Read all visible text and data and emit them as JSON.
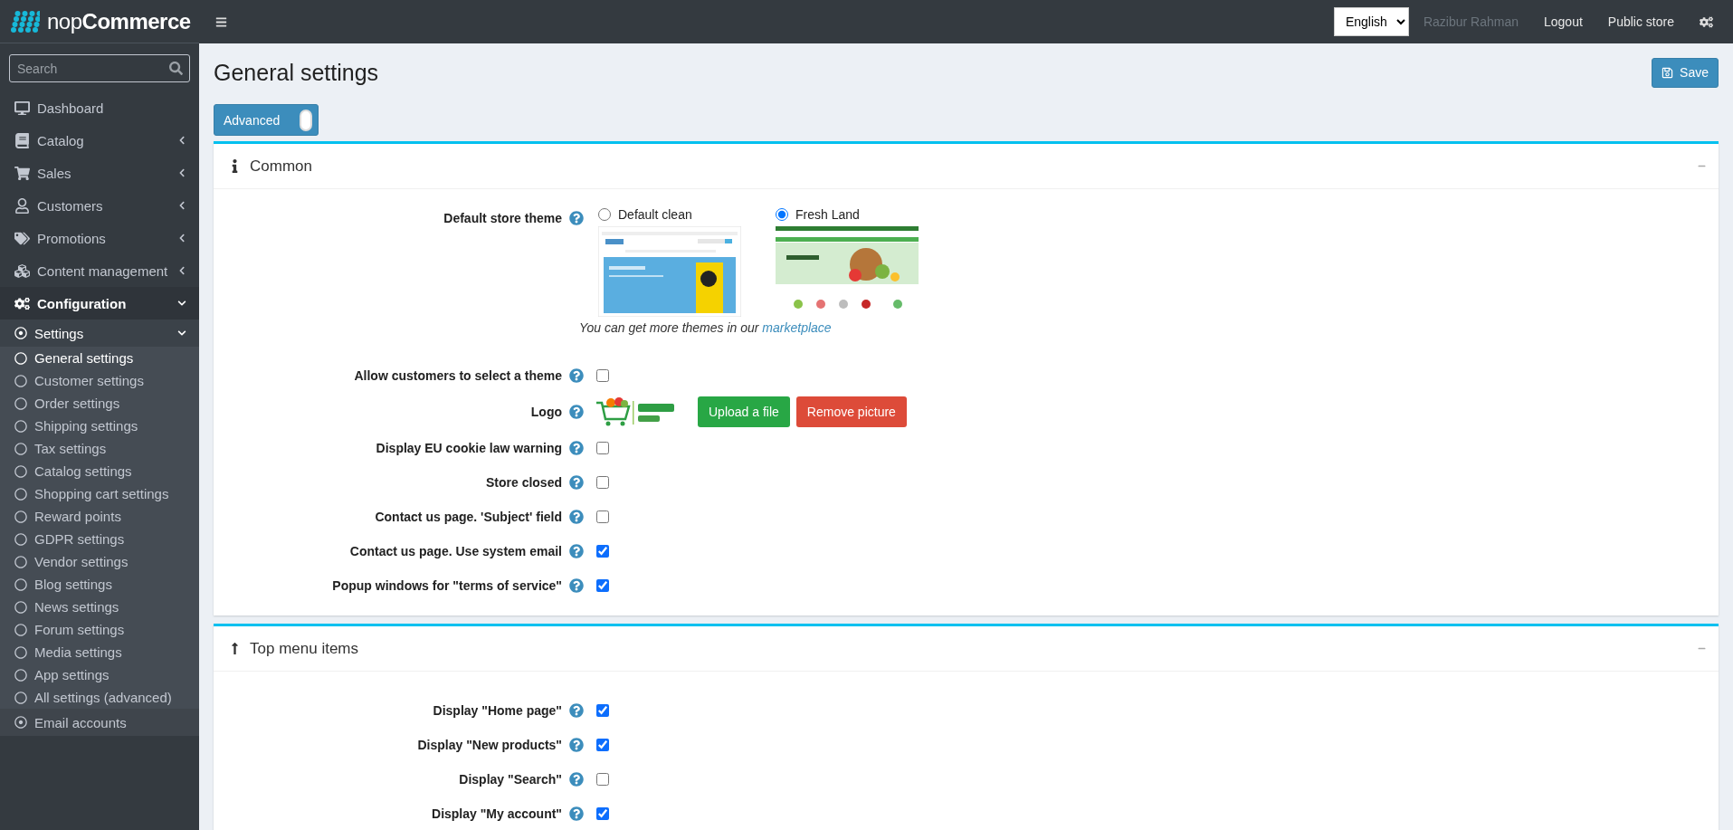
{
  "header": {
    "language": "English",
    "user": "Razibur Rahman",
    "links": [
      "Logout",
      "Public store"
    ]
  },
  "sidebar": {
    "brand_prefix": "nop",
    "brand_name": "Commerce",
    "search": {
      "placeholder": "Search"
    },
    "items": [
      {
        "label": "Dashboard"
      },
      {
        "label": "Catalog",
        "expanded": false
      },
      {
        "label": "Sales",
        "expanded": false
      },
      {
        "label": "Customers",
        "expanded": false
      },
      {
        "label": "Promotions",
        "expanded": false
      },
      {
        "label": "Content management",
        "expanded": false
      },
      {
        "label": "Configuration",
        "expanded": true,
        "children": [
          {
            "label": "Settings",
            "expanded": true,
            "children": [
              {
                "label": "General settings",
                "selected": true
              },
              {
                "label": "Customer settings",
                "selected": false
              },
              {
                "label": "Order settings",
                "selected": false
              },
              {
                "label": "Shipping settings",
                "selected": false
              },
              {
                "label": "Tax settings",
                "selected": false
              },
              {
                "label": "Catalog settings",
                "selected": false
              },
              {
                "label": "Shopping cart settings",
                "selected": false
              },
              {
                "label": "Reward points",
                "selected": false
              },
              {
                "label": "GDPR settings",
                "selected": false
              },
              {
                "label": "Vendor settings",
                "selected": false
              },
              {
                "label": "Blog settings",
                "selected": false
              },
              {
                "label": "News settings",
                "selected": false
              },
              {
                "label": "Forum settings",
                "selected": false
              },
              {
                "label": "Media settings",
                "selected": false
              },
              {
                "label": "App settings",
                "selected": false
              },
              {
                "label": "All settings (advanced)",
                "selected": false
              }
            ]
          },
          {
            "label": "Email accounts"
          }
        ]
      }
    ]
  },
  "page": {
    "title": "General settings",
    "save": "Save",
    "mode_toggle": {
      "label": "Advanced",
      "on": true
    }
  },
  "cards": [
    {
      "title": "Common",
      "expanded": true,
      "rows": [
        {
          "kind": "theme",
          "label": "Default store theme",
          "options": [
            {
              "label": "Default clean",
              "selected": false
            },
            {
              "label": "Fresh Land",
              "selected": true
            }
          ],
          "note": "You can get more themes in our",
          "link": "marketplace"
        },
        {
          "kind": "checkbox",
          "label": "Allow customers to select a theme",
          "checked": false
        },
        {
          "kind": "logo",
          "label": "Logo",
          "buttons": [
            {
              "label": "Upload a file",
              "kind": "success"
            },
            {
              "label": "Remove picture",
              "kind": "danger"
            }
          ]
        },
        {
          "kind": "checkbox",
          "label": "Display EU cookie law warning",
          "checked": false
        },
        {
          "kind": "checkbox",
          "label": "Store closed",
          "checked": false
        },
        {
          "kind": "checkbox",
          "label": "Contact us page. 'Subject' field",
          "checked": false
        },
        {
          "kind": "checkbox",
          "label": "Contact us page. Use system email",
          "checked": true
        },
        {
          "kind": "checkbox",
          "label": "Popup windows for \"terms of service\"",
          "checked": true
        }
      ]
    },
    {
      "title": "Top menu items",
      "expanded": true,
      "rows": [
        {
          "kind": "checkbox",
          "label": "Display \"Home page\"",
          "checked": true
        },
        {
          "kind": "checkbox",
          "label": "Display \"New products\"",
          "checked": true
        },
        {
          "kind": "checkbox",
          "label": "Display \"Search\"",
          "checked": false
        },
        {
          "kind": "checkbox",
          "label": "Display \"My account\"",
          "checked": true
        }
      ]
    }
  ]
}
